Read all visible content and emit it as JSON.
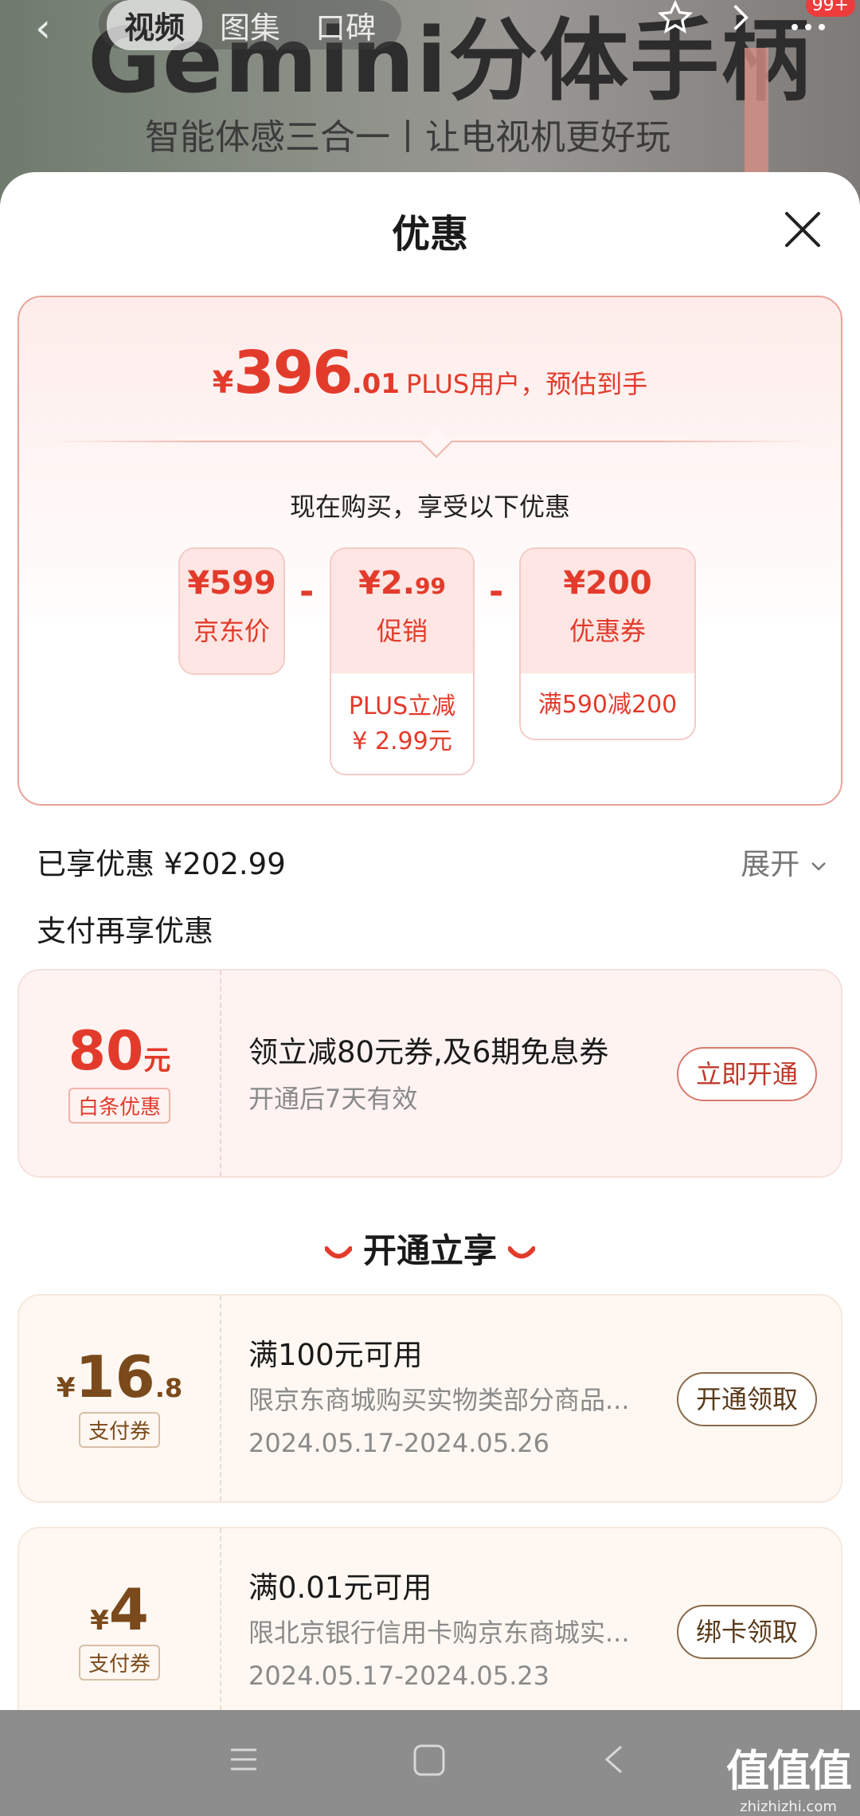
{
  "banner": {
    "bg_title": "Gemini分体手柄",
    "bg_subtitle": "智能体感三合一丨让电视机更好玩"
  },
  "nav": {
    "back_glyph": "‹",
    "tabs": [
      "视频",
      "图集",
      "口碑"
    ],
    "active_tab": "视频",
    "badge": "99+"
  },
  "sheet": {
    "title": "优惠"
  },
  "price": {
    "currency": "¥",
    "integer": "396",
    "decimal": ".01",
    "note": "PLUS用户，预估到手"
  },
  "breakdown": {
    "heading": "现在购买，享受以下优惠",
    "items": [
      {
        "amount": "¥599",
        "label": "京东价"
      },
      {
        "amount_main": "¥2.",
        "amount_small": "99",
        "label": "促销",
        "detail_line1": "PLUS立减",
        "detail_line2": "¥ 2.99元"
      },
      {
        "amount": "¥200",
        "label": "优惠券",
        "detail_line1": "满590减200"
      }
    ],
    "op": "-"
  },
  "summary": {
    "enjoyed": "已享优惠 ¥202.99",
    "expand": "展开",
    "pay_more": "支付再享优惠"
  },
  "baitiao": {
    "amount": "80",
    "unit": "元",
    "tag": "白条优惠",
    "title": "领立减80元券,及6期免息券",
    "desc": "开通后7天有效",
    "button": "立即开通"
  },
  "open_enjoy": "开通立享",
  "coupons": [
    {
      "currency": "¥",
      "int": "16",
      "dec": ".8",
      "tag": "支付券",
      "title": "满100元可用",
      "desc": "限京东商城购买实物类部分商品...",
      "dates": "2024.05.17-2024.05.26",
      "button": "开通领取"
    },
    {
      "currency": "¥",
      "int": "4",
      "dec": "",
      "tag": "支付券",
      "title": "满0.01元可用",
      "desc": "限北京银行信用卡购京东商城实...",
      "dates": "2024.05.17-2024.05.23",
      "button": "绑卡领取"
    }
  ],
  "watermark": {
    "main": "值值值",
    "sub": "zhizhizhi.com"
  },
  "colors": {
    "accent_red": "#e33b2b",
    "brown": "#7a4a1c",
    "muted": "#8a8a8a"
  }
}
